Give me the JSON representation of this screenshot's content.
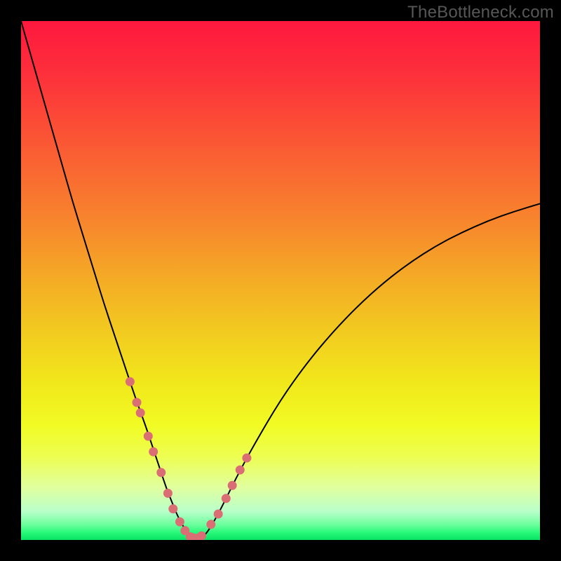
{
  "watermark": "TheBottleneck.com",
  "chart_data": {
    "type": "line",
    "title": "",
    "xlabel": "",
    "ylabel": "",
    "xlim": [
      0,
      100
    ],
    "ylim": [
      0,
      100
    ],
    "grid": false,
    "legend": false,
    "background_gradient_stops": [
      {
        "offset": 0.0,
        "color": "#fe183e"
      },
      {
        "offset": 0.1,
        "color": "#fd2f3b"
      },
      {
        "offset": 0.2,
        "color": "#fb4d36"
      },
      {
        "offset": 0.3,
        "color": "#f96b31"
      },
      {
        "offset": 0.4,
        "color": "#f78a2c"
      },
      {
        "offset": 0.5,
        "color": "#f4ac25"
      },
      {
        "offset": 0.6,
        "color": "#f2cb20"
      },
      {
        "offset": 0.7,
        "color": "#f1e81b"
      },
      {
        "offset": 0.78,
        "color": "#f1fb24"
      },
      {
        "offset": 0.84,
        "color": "#edfe52"
      },
      {
        "offset": 0.9,
        "color": "#e0ffa0"
      },
      {
        "offset": 0.945,
        "color": "#b9ffca"
      },
      {
        "offset": 0.97,
        "color": "#6dff9d"
      },
      {
        "offset": 0.985,
        "color": "#2bfa7c"
      },
      {
        "offset": 1.0,
        "color": "#08e263"
      }
    ],
    "series": [
      {
        "name": "bottleneck-curve",
        "stroke": "#000000",
        "stroke_width": 2,
        "x": [
          0.0,
          2,
          4,
          6,
          8,
          10,
          12,
          14,
          16,
          18,
          20,
          22,
          24,
          25,
          26,
          27,
          28,
          29,
          30,
          31,
          32,
          33,
          34,
          35,
          36,
          38,
          40,
          42,
          45,
          50,
          55,
          60,
          65,
          70,
          75,
          80,
          85,
          90,
          95,
          100
        ],
        "y": [
          100,
          93,
          86,
          79,
          72,
          65,
          58.5,
          52,
          45.5,
          39.5,
          33.5,
          27.5,
          22,
          19,
          16,
          13,
          10,
          7.5,
          5,
          3,
          1.6,
          0.6,
          0.2,
          0.6,
          1.6,
          5,
          9,
          13,
          18.5,
          27,
          34,
          40,
          45.2,
          49.7,
          53.5,
          56.7,
          59.3,
          61.5,
          63.3,
          64.8
        ]
      }
    ],
    "markers": {
      "name": "highlight-dots",
      "fill": "#d96f75",
      "radius": 6.5,
      "x": [
        21.0,
        22.3,
        23.0,
        24.5,
        25.5,
        27.0,
        28.3,
        29.3,
        30.6,
        31.6,
        32.6,
        33.2,
        34.2,
        34.8,
        36.6,
        38.0,
        39.5,
        40.7,
        42.2,
        43.5
      ],
      "y": [
        30.5,
        26.5,
        24.5,
        20.0,
        17.0,
        13.0,
        9.0,
        6.0,
        3.5,
        1.8,
        0.6,
        0.4,
        0.4,
        0.8,
        3.0,
        5.0,
        8.0,
        10.5,
        13.5,
        15.8
      ]
    }
  }
}
